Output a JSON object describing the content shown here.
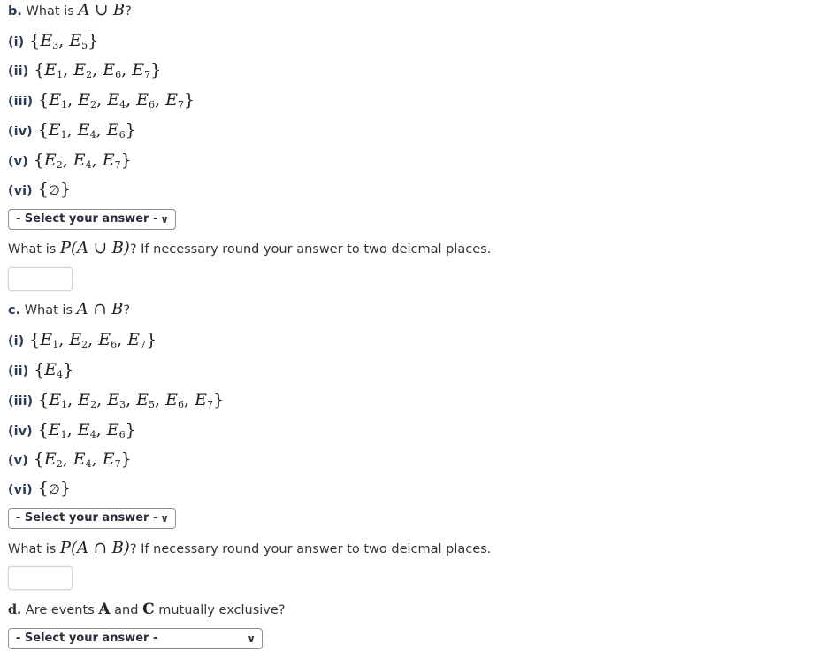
{
  "part_b": {
    "label": "b.",
    "question_prefix": "What is",
    "question_math": "A ∪ B",
    "question_suffix": "?",
    "options": [
      {
        "label": "(i)",
        "set": [
          "E3",
          "E5"
        ]
      },
      {
        "label": "(ii)",
        "set": [
          "E1",
          "E2",
          "E6",
          "E7"
        ]
      },
      {
        "label": "(iii)",
        "set": [
          "E1",
          "E2",
          "E4",
          "E6",
          "E7"
        ]
      },
      {
        "label": "(iv)",
        "set": [
          "E1",
          "E4",
          "E6"
        ]
      },
      {
        "label": "(v)",
        "set": [
          "E2",
          "E4",
          "E7"
        ]
      },
      {
        "label": "(vi)",
        "set": [
          "∅"
        ]
      }
    ],
    "select_value": "- Select your answer -",
    "prob_prefix": "What is",
    "prob_math": "P(A ∪ B)",
    "prob_suffix": "? If necessary round your answer to two deicmal places.",
    "prob_input_value": ""
  },
  "part_c": {
    "label": "c.",
    "question_prefix": "What is",
    "question_math": "A ∩ B",
    "question_suffix": "?",
    "options": [
      {
        "label": "(i)",
        "set": [
          "E1",
          "E2",
          "E6",
          "E7"
        ]
      },
      {
        "label": "(ii)",
        "set": [
          "E4"
        ]
      },
      {
        "label": "(iii)",
        "set": [
          "E1",
          "E2",
          "E3",
          "E5",
          "E6",
          "E7"
        ]
      },
      {
        "label": "(iv)",
        "set": [
          "E1",
          "E4",
          "E6"
        ]
      },
      {
        "label": "(v)",
        "set": [
          "E2",
          "E4",
          "E7"
        ]
      },
      {
        "label": "(vi)",
        "set": [
          "∅"
        ]
      }
    ],
    "select_value": "- Select your answer -",
    "prob_prefix": "What is",
    "prob_math": "P(A ∩ B)",
    "prob_suffix": "? If necessary round your answer to two deicmal places.",
    "prob_input_value": ""
  },
  "part_d": {
    "label": "d.",
    "question_prefix": "Are events",
    "event1": "A",
    "joiner": "and",
    "event2": "C",
    "question_suffix": "mutually exclusive?",
    "select_value": "- Select your answer -"
  },
  "icons": {
    "dropdown": "chevron-down-icon"
  }
}
